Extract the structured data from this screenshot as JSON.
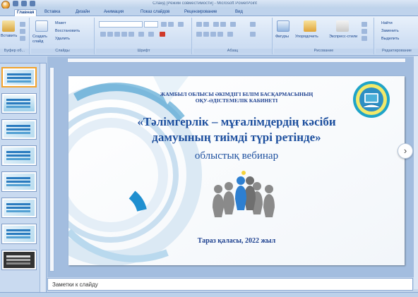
{
  "window": {
    "title": "Слайд [Режим совместимости] - Microsoft PowerPoint"
  },
  "tabs": [
    "Главная",
    "Вставка",
    "Дизайн",
    "Анимация",
    "Показ слайдов",
    "Рецензирование",
    "Вид"
  ],
  "ribbon": {
    "clipboard": {
      "label": "Буфер об...",
      "paste": "Вставить"
    },
    "slides": {
      "label": "Слайды",
      "new_slide": "Создать слайд",
      "layout": "Макет",
      "reset": "Восстановить",
      "delete": "Удалить"
    },
    "font": {
      "label": "Шрифт"
    },
    "paragraph": {
      "label": "Абзац"
    },
    "drawing": {
      "label": "Рисование",
      "shapes": "Фигуры",
      "arrange": "Упорядочить",
      "styles": "Экспресс-стили"
    },
    "editing": {
      "label": "Редактирование",
      "find": "Найти",
      "replace": "Заменить",
      "select": "Выделить"
    }
  },
  "slide": {
    "header_line1": "ЖАМБЫЛ ОБЛЫСЫ ӘКІМДІГІ БІЛІМ БАСҚАРМАСЫНЫҢ",
    "header_line2": "ОҚУ-ӘДІСТЕМЕЛІК КАБИНЕТІ",
    "title": "«Тәлімгерлік – мұғалімдердің кәсіби дамуының тиімді түрі ретінде»",
    "subtitle": "облыстық вебинар",
    "footer": "Тараз қаласы, 2022 жыл"
  },
  "thumbnails": [
    1,
    2,
    3,
    4,
    5,
    6,
    7,
    8
  ],
  "notes": {
    "placeholder": "Заметки к слайду"
  },
  "colors": {
    "accent": "#1d4f9e",
    "ribbon": "#d2e1f4",
    "workspace": "#a3bddf"
  },
  "icons": {
    "next": "chevron-right-icon"
  }
}
